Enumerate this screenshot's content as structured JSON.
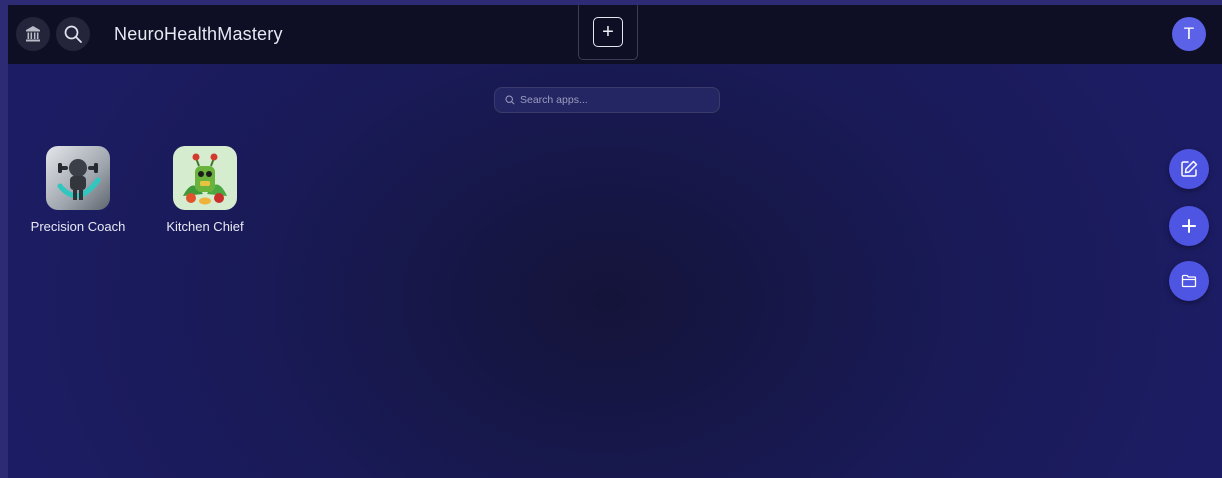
{
  "header": {
    "brand": "NeuroHealthMastery",
    "home_icon": "bank-icon",
    "search_icon": "search-icon",
    "create_icon": "plus-icon",
    "create_label": "+",
    "avatar_initial": "T"
  },
  "search": {
    "placeholder": "Search apps..."
  },
  "apps": [
    {
      "label": "Precision Coach",
      "icon": "fitness-robot-icon"
    },
    {
      "label": "Kitchen Chief",
      "icon": "vegetable-robot-icon"
    }
  ],
  "side_actions": [
    {
      "icon": "edit-icon"
    },
    {
      "icon": "plus-icon"
    },
    {
      "icon": "folder-icon"
    }
  ],
  "colors": {
    "accent": "#4e55e3",
    "avatar": "#5b62e8",
    "topbar": "#0e0f24",
    "background": "#1a1b5c",
    "outer_border": "#2c2b74"
  }
}
